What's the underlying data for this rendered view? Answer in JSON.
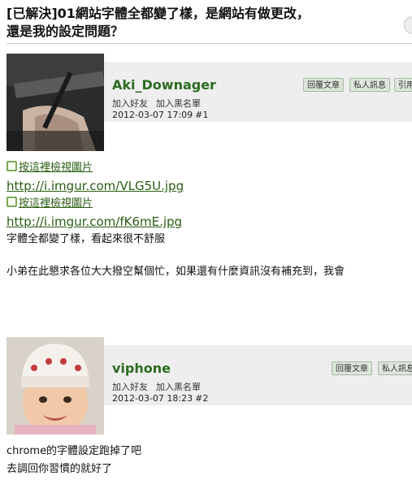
{
  "thread": {
    "title_line1": "[已解決]01網站字體全都變了樣，是網站有做更改，",
    "title_line2": "還是我的設定問題？"
  },
  "posts": [
    {
      "username": "Aki_Downager",
      "add_friend": "加入好友",
      "add_blacklist": "加入黑名單",
      "date": "2012-03-07 17:09",
      "number": "#1",
      "buttons": [
        "回覆文章",
        "私人訊息",
        "引用"
      ],
      "image_link_1": "按這裡檢視圖片",
      "url_1": "http://i.imgur.com/VLG5U.jpg",
      "image_link_2": "按這裡檢視圖片",
      "url_2": "http://i.imgur.com/fK6mE.jpg",
      "line_1": "字體全都變了樣，看起來很不舒服",
      "line_2": "小弟在此懇求各位大大撥空幫個忙，如果還有什麼資訊沒有補充到，我會"
    },
    {
      "username": "viphone",
      "add_friend": "加入好友",
      "add_blacklist": "加入黑名單",
      "date": "2012-03-07 18:23",
      "number": "#2",
      "buttons": [
        "回覆文章",
        "私人訊息"
      ],
      "line_1": "chrome的字體設定跑掉了吧",
      "line_2": "去調回你習慣的就好了"
    }
  ]
}
